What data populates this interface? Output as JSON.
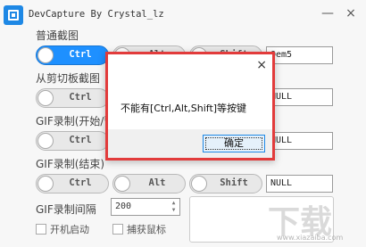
{
  "window": {
    "title": "DevCapture By Crystal_lz"
  },
  "sections": [
    {
      "label": "普通截图"
    },
    {
      "label": "从剪切板截图"
    },
    {
      "label": "GIF录制(开始/暂"
    },
    {
      "label": "GIF录制(结束)"
    }
  ],
  "rows": [
    {
      "ctrl": "Ctrl",
      "alt": "Alt",
      "shift": "Shift",
      "key": "Oem5",
      "ctrl_on": true,
      "alt_on": false,
      "shift_on": false
    },
    {
      "ctrl": "Ctrl",
      "alt": "",
      "shift": "",
      "key": "NULL",
      "ctrl_on": false
    },
    {
      "ctrl": "Ctrl",
      "alt": "",
      "shift": "",
      "key": "NULL",
      "ctrl_on": false
    },
    {
      "ctrl": "Ctrl",
      "alt": "Alt",
      "shift": "Shift",
      "key": "NULL",
      "ctrl_on": false
    }
  ],
  "gif_interval": {
    "label": "GIF录制间隔",
    "value": "200"
  },
  "checkboxes": {
    "startup": "开机启动",
    "capture_cursor": "捕获鼠标"
  },
  "dialog": {
    "message": "不能有[Ctrl,Alt,Shift]等按键",
    "ok_label": "确定",
    "close_glyph": "×"
  },
  "titlebar_buttons": {
    "minimize": "—",
    "close": "×"
  },
  "watermark": {
    "text": "下载",
    "sub": "www.xiazaiba.com"
  },
  "colors": {
    "accent": "#1e90ff",
    "dialog_border": "#e23b3b"
  }
}
